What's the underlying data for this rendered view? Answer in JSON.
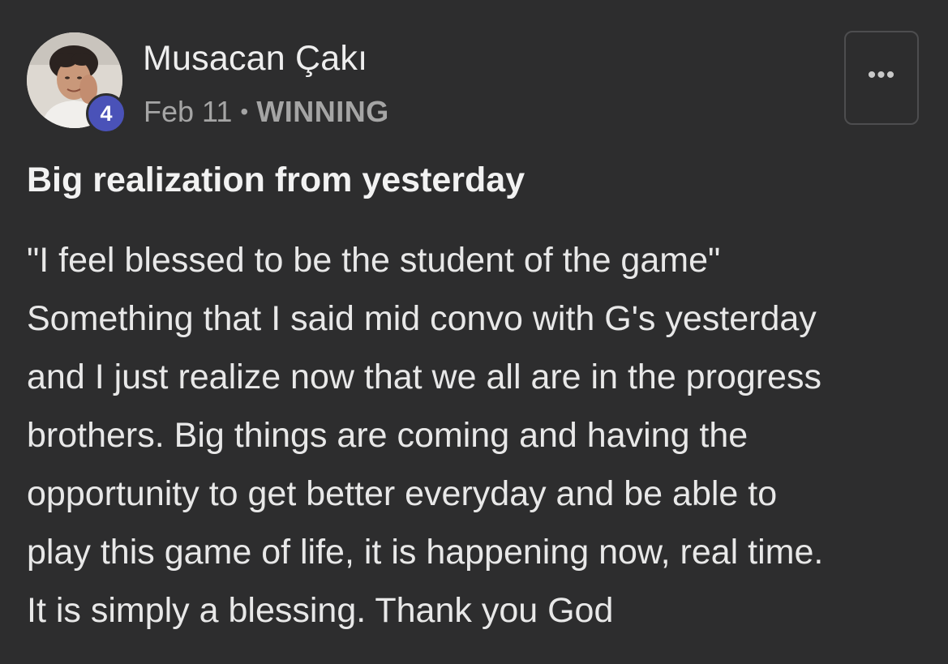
{
  "author": {
    "name": "Musacan Çakı",
    "level": "4"
  },
  "meta": {
    "date": "Feb 11",
    "separator": "•",
    "category": "WINNING"
  },
  "more_button": {
    "icon": "more-horizontal-icon",
    "glyph": "•••"
  },
  "post": {
    "title": "Big realization from yesterday",
    "body_lines": [
      "\"I feel blessed to be the student of the game\"",
      "Something that I said mid convo with G's yesterday",
      "and I just realize now that we all are in the progress",
      "brothers. Big things are coming and having the",
      "opportunity to get better everyday and be able to",
      "play this game of life, it is happening now, real time.",
      "It is simply a blessing. Thank you God"
    ]
  },
  "colors": {
    "background": "#2d2d2e",
    "badge": "#4a52b8",
    "meta_text": "#a5a5a5",
    "text": "#ececec"
  }
}
